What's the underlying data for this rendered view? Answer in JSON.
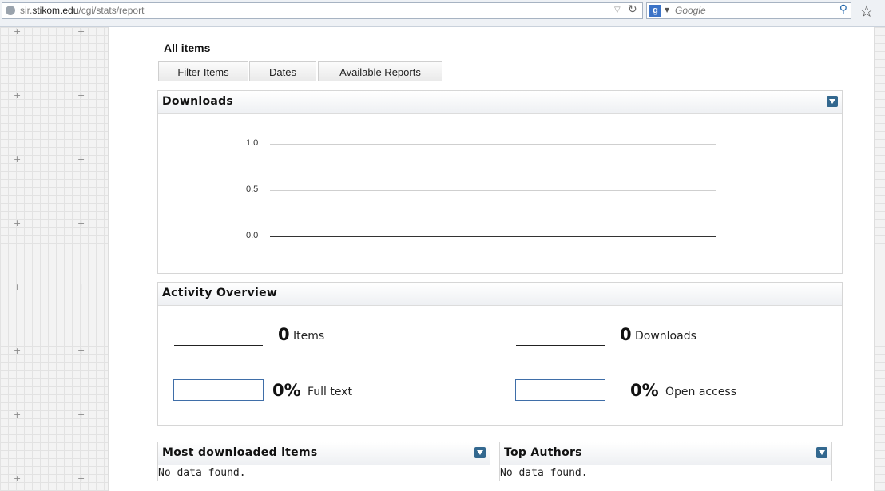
{
  "browser": {
    "url_prefix": "sir.",
    "url_domain": "stikom.edu",
    "url_path": "/cgi/stats/report",
    "search_placeholder": "Google",
    "search_engine_glyph": "g"
  },
  "page": {
    "title": "All items",
    "tabs": [
      "Filter Items",
      "Dates",
      "Available Reports"
    ]
  },
  "downloads_panel": {
    "title": "Downloads"
  },
  "chart_data": {
    "type": "line",
    "title": "",
    "xlabel": "",
    "ylabel": "",
    "ylim": [
      0,
      1
    ],
    "yticks": [
      "1.0",
      "0.5",
      "0.0"
    ],
    "series": [],
    "grid": true
  },
  "activity_panel": {
    "title": "Activity Overview",
    "items_count": "0",
    "items_label": "Items",
    "downloads_count": "0",
    "downloads_label": "Downloads",
    "fulltext_pct": "0%",
    "fulltext_label": "Full text",
    "openaccess_pct": "0%",
    "openaccess_label": "Open access"
  },
  "most_downloaded": {
    "title": "Most downloaded items",
    "message": "No data found."
  },
  "top_authors": {
    "title": "Top Authors",
    "message": "No data found."
  },
  "colors": {
    "toggle": "#33688f",
    "box_border": "#3f6ea8"
  }
}
